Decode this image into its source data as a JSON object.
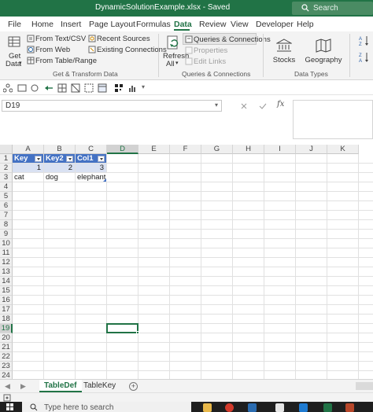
{
  "window": {
    "title": "DynamicSolutionExample.xlsx - Saved",
    "search_placeholder": "Search"
  },
  "ribbon_tabs": [
    "File",
    "Home",
    "Insert",
    "Page Layout",
    "Formulas",
    "Data",
    "Review",
    "View",
    "Developer",
    "Help"
  ],
  "active_tab": "Data",
  "ribbon": {
    "get_data_line1": "Get",
    "get_data_line2": "Data",
    "from_text_csv": "From Text/CSV",
    "from_web": "From Web",
    "from_table_range": "From Table/Range",
    "recent_sources": "Recent Sources",
    "existing_connections": "Existing Connections",
    "group_get_transform": "Get & Transform Data",
    "refresh_all_line1": "Refresh",
    "refresh_all_line2": "All",
    "queries_connections": "Queries & Connections",
    "properties": "Properties",
    "edit_links": "Edit Links",
    "group_queries": "Queries & Connections",
    "stocks": "Stocks",
    "geography": "Geography",
    "group_data_types": "Data Types"
  },
  "formula_bar": {
    "name_box": "D19",
    "fx_label": "fx",
    "formula": ""
  },
  "grid": {
    "columns": [
      "A",
      "B",
      "C",
      "D",
      "E",
      "F",
      "G",
      "H",
      "I",
      "J",
      "K"
    ],
    "rows": [
      "1",
      "2",
      "3",
      "4",
      "5",
      "6",
      "7",
      "8",
      "9",
      "10",
      "11",
      "12",
      "13",
      "14",
      "15",
      "16",
      "17",
      "18",
      "19",
      "20",
      "21",
      "22",
      "23",
      "24"
    ],
    "selected_column": "D",
    "selected_row": "19",
    "table_headers": [
      "Key",
      "Key2",
      "Col1"
    ],
    "table_row1": [
      "1",
      "2",
      "3"
    ],
    "table_row2": [
      "cat",
      "dog",
      "elephant"
    ]
  },
  "sheets": [
    "TableDef",
    "TableKey"
  ],
  "active_sheet": "TableDef",
  "taskbar": {
    "search_text": "Type here to search"
  },
  "colors": {
    "excel_green": "#217346",
    "table_header": "#4472c4",
    "table_band": "#d9e1f2"
  }
}
